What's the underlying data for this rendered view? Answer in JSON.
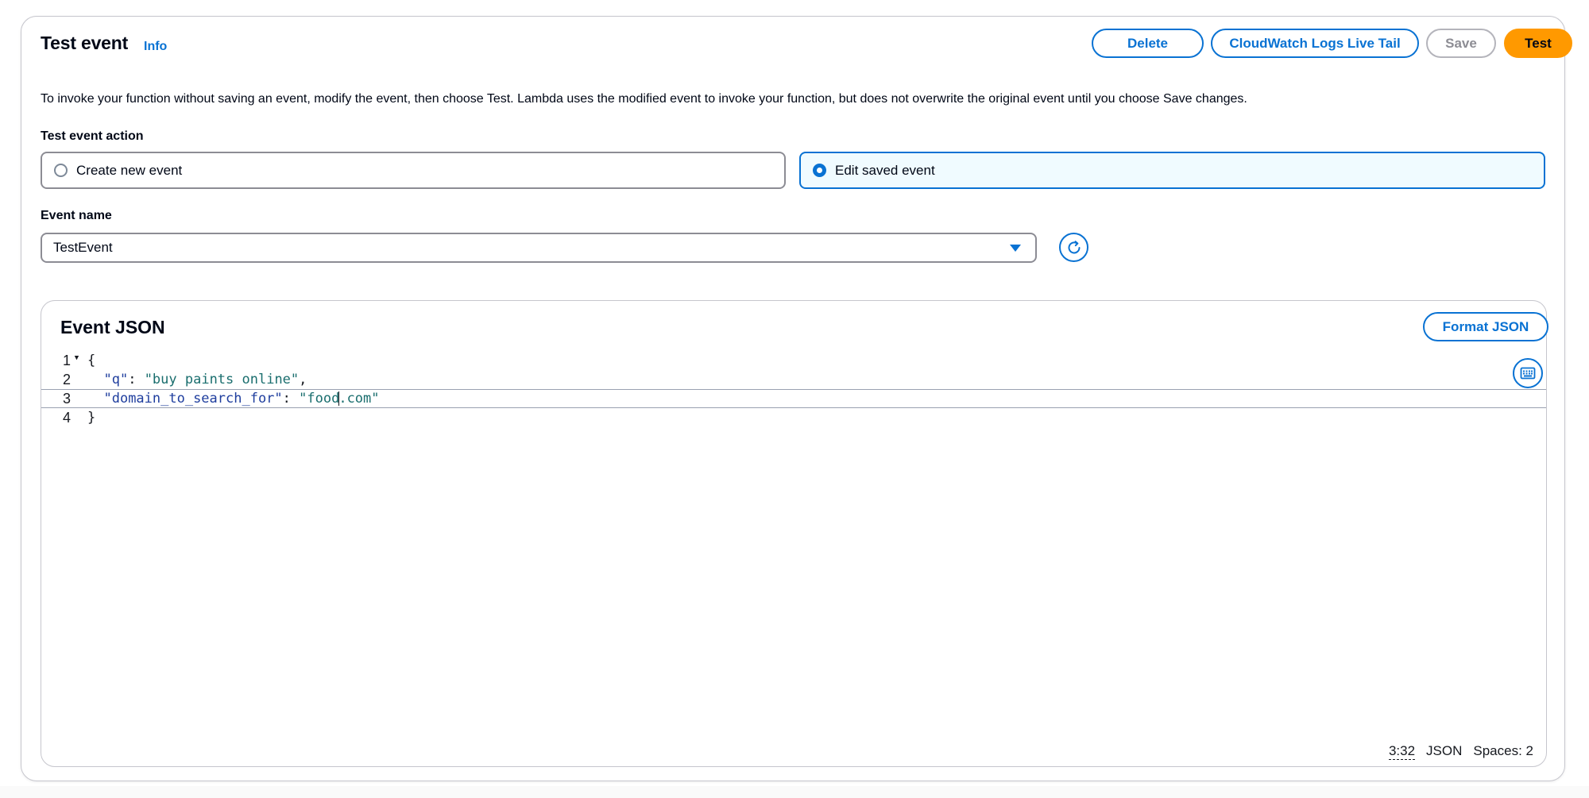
{
  "header": {
    "title": "Test event",
    "info_link": "Info",
    "buttons": {
      "delete": "Delete",
      "live_tail": "CloudWatch Logs Live Tail",
      "save": "Save",
      "test": "Test"
    }
  },
  "description": "To invoke your function without saving an event, modify the event, then choose Test. Lambda uses the modified event to invoke your function, but does not overwrite the original event until you choose Save changes.",
  "test_event_action": {
    "label": "Test event action",
    "options": [
      {
        "label": "Create new event",
        "selected": false
      },
      {
        "label": "Edit saved event",
        "selected": true
      }
    ]
  },
  "event_name": {
    "label": "Event name",
    "value": "TestEvent"
  },
  "editor": {
    "title": "Event JSON",
    "format_button": "Format JSON",
    "lines": [
      {
        "number": "1",
        "text": "{"
      },
      {
        "number": "2",
        "key": "\"q\"",
        "value": "\"buy paints online\"",
        "trail": ","
      },
      {
        "number": "3",
        "key": "\"domain_to_search_for\"",
        "value_a": "\"food",
        "value_b": ".com\"",
        "trail": ""
      },
      {
        "number": "4",
        "text": "}"
      }
    ],
    "status": {
      "position": "3:32",
      "language": "JSON",
      "indent": "Spaces: 2"
    }
  },
  "icons": {
    "refresh": "refresh-icon",
    "fold": "fold-caret-icon",
    "settings": "keyboard-settings-icon",
    "dropdown": "caret-down-icon"
  },
  "colors": {
    "accent": "#0972d3",
    "primary_button": "#ff9900",
    "selected_tile_bg": "#f0fbff"
  }
}
